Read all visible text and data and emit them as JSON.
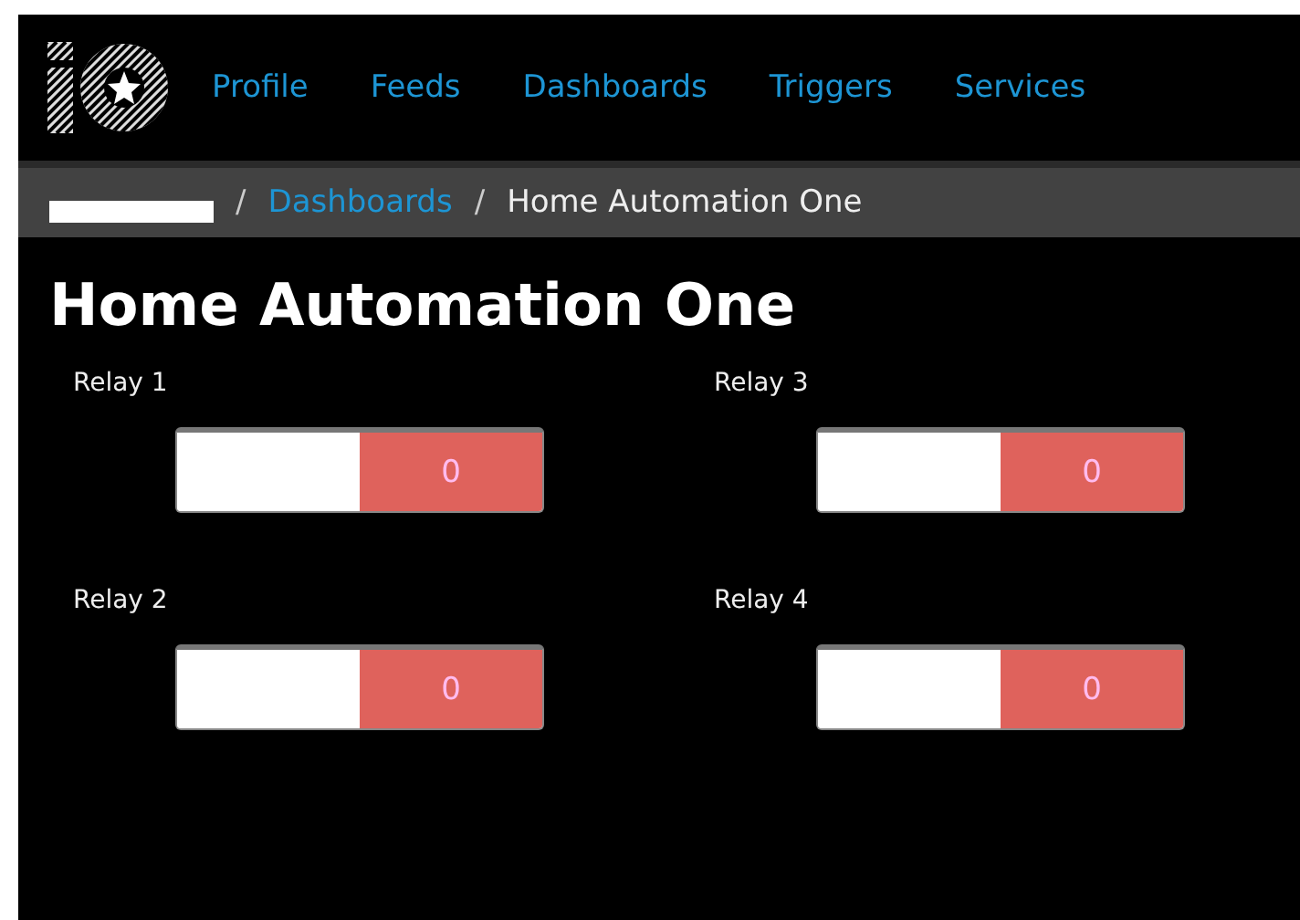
{
  "nav": {
    "items": [
      "Profile",
      "Feeds",
      "Dashboards",
      "Triggers",
      "Services"
    ]
  },
  "breadcrumb": {
    "separator": "/",
    "items": [
      "Dashboards",
      "Home Automation One"
    ]
  },
  "title": "Home Automation One",
  "blocks": [
    {
      "label": "Relay 1",
      "on": false,
      "value": "0"
    },
    {
      "label": "Relay 3",
      "on": false,
      "value": "0"
    },
    {
      "label": "Relay 2",
      "on": false,
      "value": "0"
    },
    {
      "label": "Relay 4",
      "on": false,
      "value": "0"
    }
  ]
}
